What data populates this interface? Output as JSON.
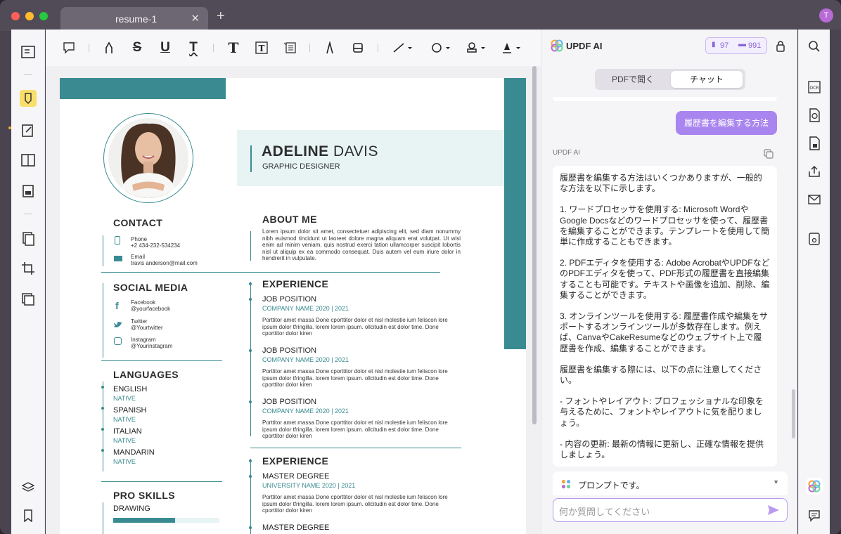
{
  "window": {
    "tab_title": "resume-1",
    "tab_close": "✕",
    "new_tab": "+",
    "user_initial": "T"
  },
  "toolbar": {
    "tools": [
      "comment",
      "highlight",
      "strikethrough",
      "underline",
      "squiggly",
      "text",
      "textbox",
      "text-callout",
      "pencil",
      "eraser",
      "line",
      "shape",
      "stamp",
      "signature"
    ]
  },
  "resume": {
    "first_name": "ADELINE",
    "last_name": " DAVIS",
    "role": "GRAPHIC DESIGNER",
    "contact_title": "CONTACT",
    "phone_label": "Phone",
    "phone": "+2 434-232-534234",
    "email_label": "Email",
    "email": "travis anderson@mail.com",
    "about_title": "ABOUT ME",
    "about_text": "Lorem ipsum dolor sit amet, consectetuer adipiscing elit, sed diam nonummy nibh euismod tincidunt ut laoreet dolore magna aliquam erat volutpat. Ut wisi enim ad minim veniam, quis nostrud exerci tation ullamcorper suscipit lobortis nisl ut aliquip ex ea commodo consequat. Duis autem vel eum iriure dolor in hendrerit in vulputate.",
    "social_title": "SOCIAL MEDIA",
    "social": [
      {
        "label": "Facebook",
        "handle": "@yourfacebook"
      },
      {
        "label": "Twitter",
        "handle": "@Yourtwitter"
      },
      {
        "label": "Instagram",
        "handle": "@Yourinstagram"
      }
    ],
    "languages_title": "LANGUAGES",
    "languages": [
      {
        "name": "ENGLISH",
        "level": "NATIVE"
      },
      {
        "name": "SPANISH",
        "level": "NATIVE"
      },
      {
        "name": "ITALIAN",
        "level": "NATIVE"
      },
      {
        "name": "MANDARIN",
        "level": "NATIVE"
      }
    ],
    "skills_title": "PRO SKILLS",
    "skill": {
      "name": "DRAWING",
      "level": 0.58
    },
    "experience_title": "EXPERIENCE",
    "jobs": [
      {
        "title": "JOB POSITION",
        "company": "COMPANY NAME 2020 | 2021",
        "desc": "Porttitor amet massa Done cporttitor dolor et nisl molestie ium feliscon lore ipsum dolor tfringilla. lorem lorem ipsum. ollcitudin est dolor time. Done cporttitor dolor kiren"
      },
      {
        "title": "JOB POSITION",
        "company": "COMPANY NAME 2020 | 2021",
        "desc": "Porttitor amet massa Done cporttitor dolor et nisl molestie ium feliscon lore ipsum dolor tfringilla. lorem lorem ipsum. ollcitudin est dolor time. Done cporttitor dolor kiren"
      },
      {
        "title": "JOB POSITION",
        "company": "COMPANY NAME 2020 | 2021",
        "desc": "Porttitor amet massa Done cporttitor dolor et nisl molestie ium feliscon lore ipsum dolor tfringilla. lorem lorem ipsum. ollcitudin est dolor time. Done cporttitor dolor kiren"
      }
    ],
    "education_title": "EXPERIENCE",
    "education": [
      {
        "title": "MASTER DEGREE",
        "school": "UNIVERSITY NAME 2020 | 2021",
        "desc": "Porttitor amet massa Done cporttitor dolor et nisl molestie ium feliscon lore ipsum dolor tfringilla. lorem lorem ipsum. ollcitudin est dolor time. Done cporttitor dolor kiren"
      },
      {
        "title": "MASTER DEGREE"
      }
    ]
  },
  "ai_panel": {
    "title": "UPDF AI",
    "credits_a": "97",
    "credits_b": "991",
    "tab_pdf": "PDFで聞く",
    "tab_chat": "チャット",
    "user_message": "履歴書を編集する方法",
    "ai_label": "UPDF AI",
    "answer": [
      "履歴書を編集する方法はいくつかありますが、一般的な方法を以下に示します。",
      "1. ワードプロセッサを使用する: Microsoft WordやGoogle Docsなどのワードプロセッサを使って、履歴書を編集することができます。テンプレートを使用して簡単に作成することもできます。",
      "2. PDFエディタを使用する: Adobe AcrobatやUPDFなどのPDFエディタを使って、PDF形式の履歴書を直接編集することも可能です。テキストや画像を追加、削除、編集することができます。",
      "3. オンラインツールを使用する: 履歴書作成や編集をサポートするオンラインツールが多数存在します。例えば、CanvaやCakeResumeなどのウェブサイト上で履歴書を作成、編集することができます。",
      "履歴書を編集する際には、以下の点に注意してください。",
      "- フォントやレイアウト: プロフェッショナルな印象を与えるために、フォントやレイアウトに気を配りましょう。",
      "- 内容の更新: 最新の情報に更新し、正確な情報を提供しましょう。"
    ],
    "prompt_label": "プロンプトです。",
    "input_placeholder": "何か質問してください"
  },
  "colors": {
    "accent_teal": "#3a8b91",
    "ai_purple": "#a985f0"
  }
}
